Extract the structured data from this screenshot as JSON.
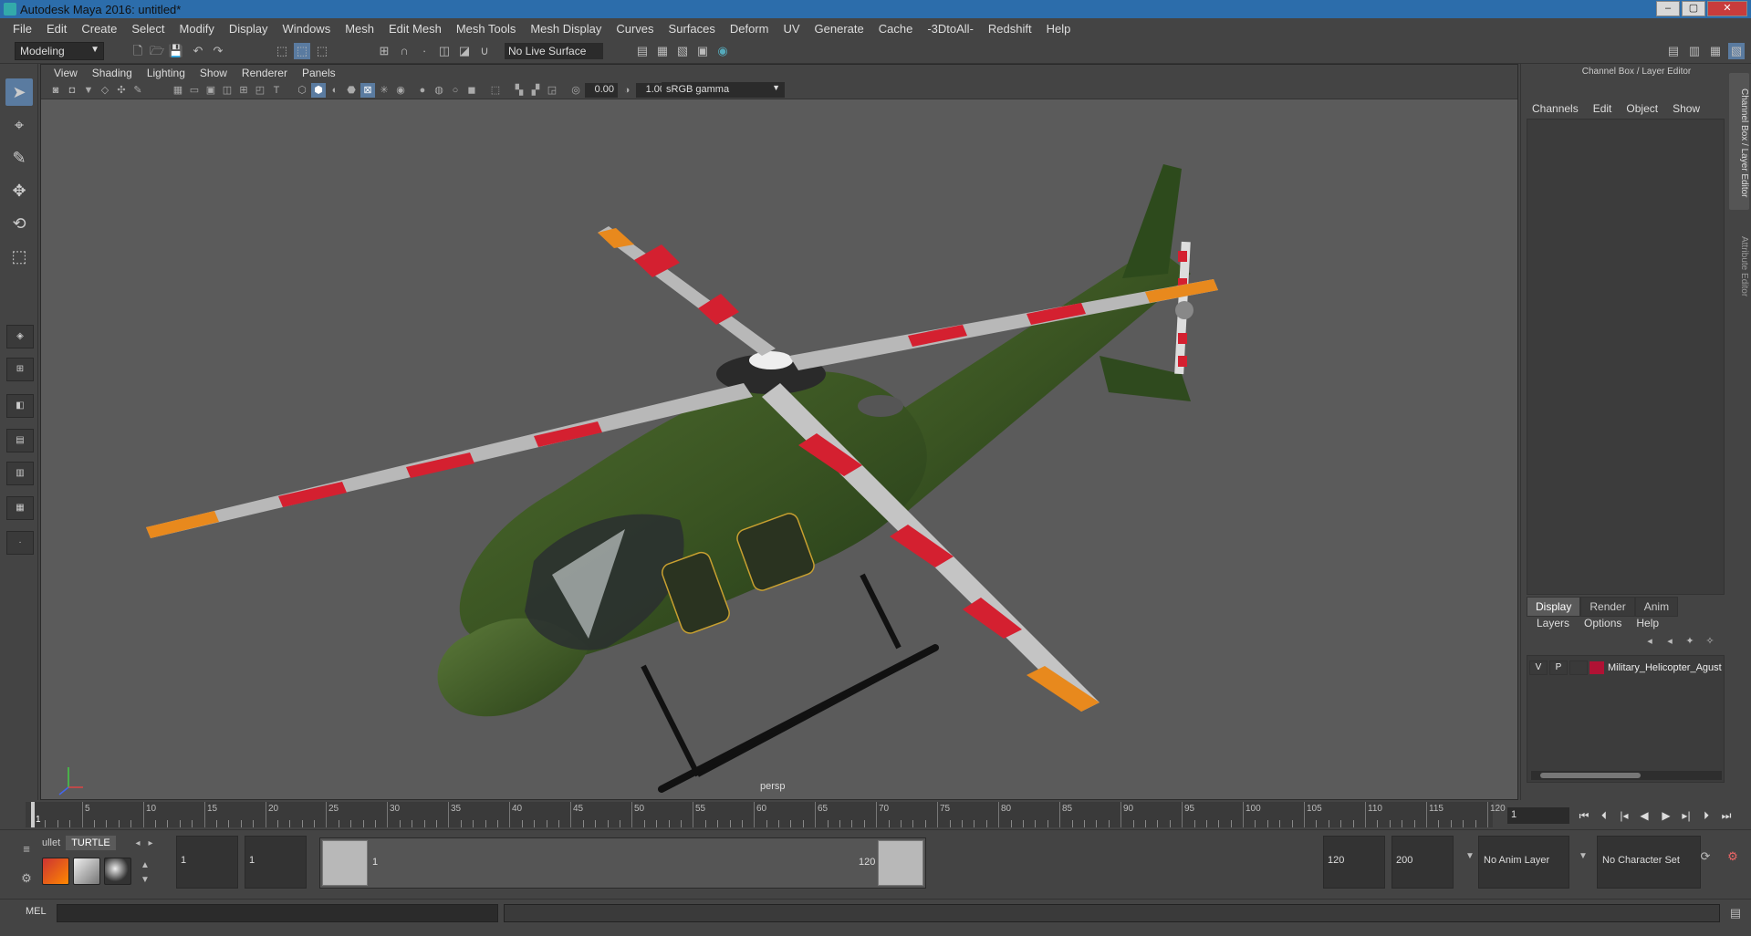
{
  "window": {
    "title": "Autodesk Maya 2016: untitled*"
  },
  "menubar": [
    "File",
    "Edit",
    "Create",
    "Select",
    "Modify",
    "Display",
    "Windows",
    "Mesh",
    "Edit Mesh",
    "Mesh Tools",
    "Mesh Display",
    "Curves",
    "Surfaces",
    "Deform",
    "UV",
    "Generate",
    "Cache",
    "-3DtoAll-",
    "Redshift",
    "Help"
  ],
  "statusline": {
    "mode": "Modeling",
    "live_surface": "No Live Surface"
  },
  "viewport": {
    "menu": [
      "View",
      "Shading",
      "Lighting",
      "Show",
      "Renderer",
      "Panels"
    ],
    "exposure": "0.00",
    "gamma_value": "1.00",
    "color_space": "sRGB gamma",
    "camera": "persp"
  },
  "right_panel": {
    "title": "Channel Box / Layer Editor",
    "menu": [
      "Channels",
      "Edit",
      "Object",
      "Show"
    ],
    "side_tabs": [
      "Channel Box / Layer Editor",
      "Attribute Editor"
    ],
    "layer_tabs": [
      "Display",
      "Render",
      "Anim"
    ],
    "layer_menu": [
      "Layers",
      "Options",
      "Help"
    ],
    "layer": {
      "v": "V",
      "p": "P",
      "name": "Military_Helicopter_Agust",
      "color": "#b01234"
    }
  },
  "timeline": {
    "ticks": [
      "1",
      "5",
      "10",
      "15",
      "20",
      "25",
      "30",
      "35",
      "40",
      "45",
      "50",
      "55",
      "60",
      "65",
      "70",
      "75",
      "80",
      "85",
      "90",
      "95",
      "100",
      "105",
      "110",
      "115",
      "120"
    ],
    "current_frame": "1"
  },
  "range": {
    "shelf_tabs": [
      "ullet",
      "TURTLE"
    ],
    "start": "1",
    "playback_start": "1",
    "slider_start": "1",
    "slider_end": "120",
    "playback_end": "120",
    "end": "200",
    "anim_layer": "No Anim Layer",
    "character_set": "No Character Set"
  },
  "command_line": {
    "label": "MEL"
  }
}
